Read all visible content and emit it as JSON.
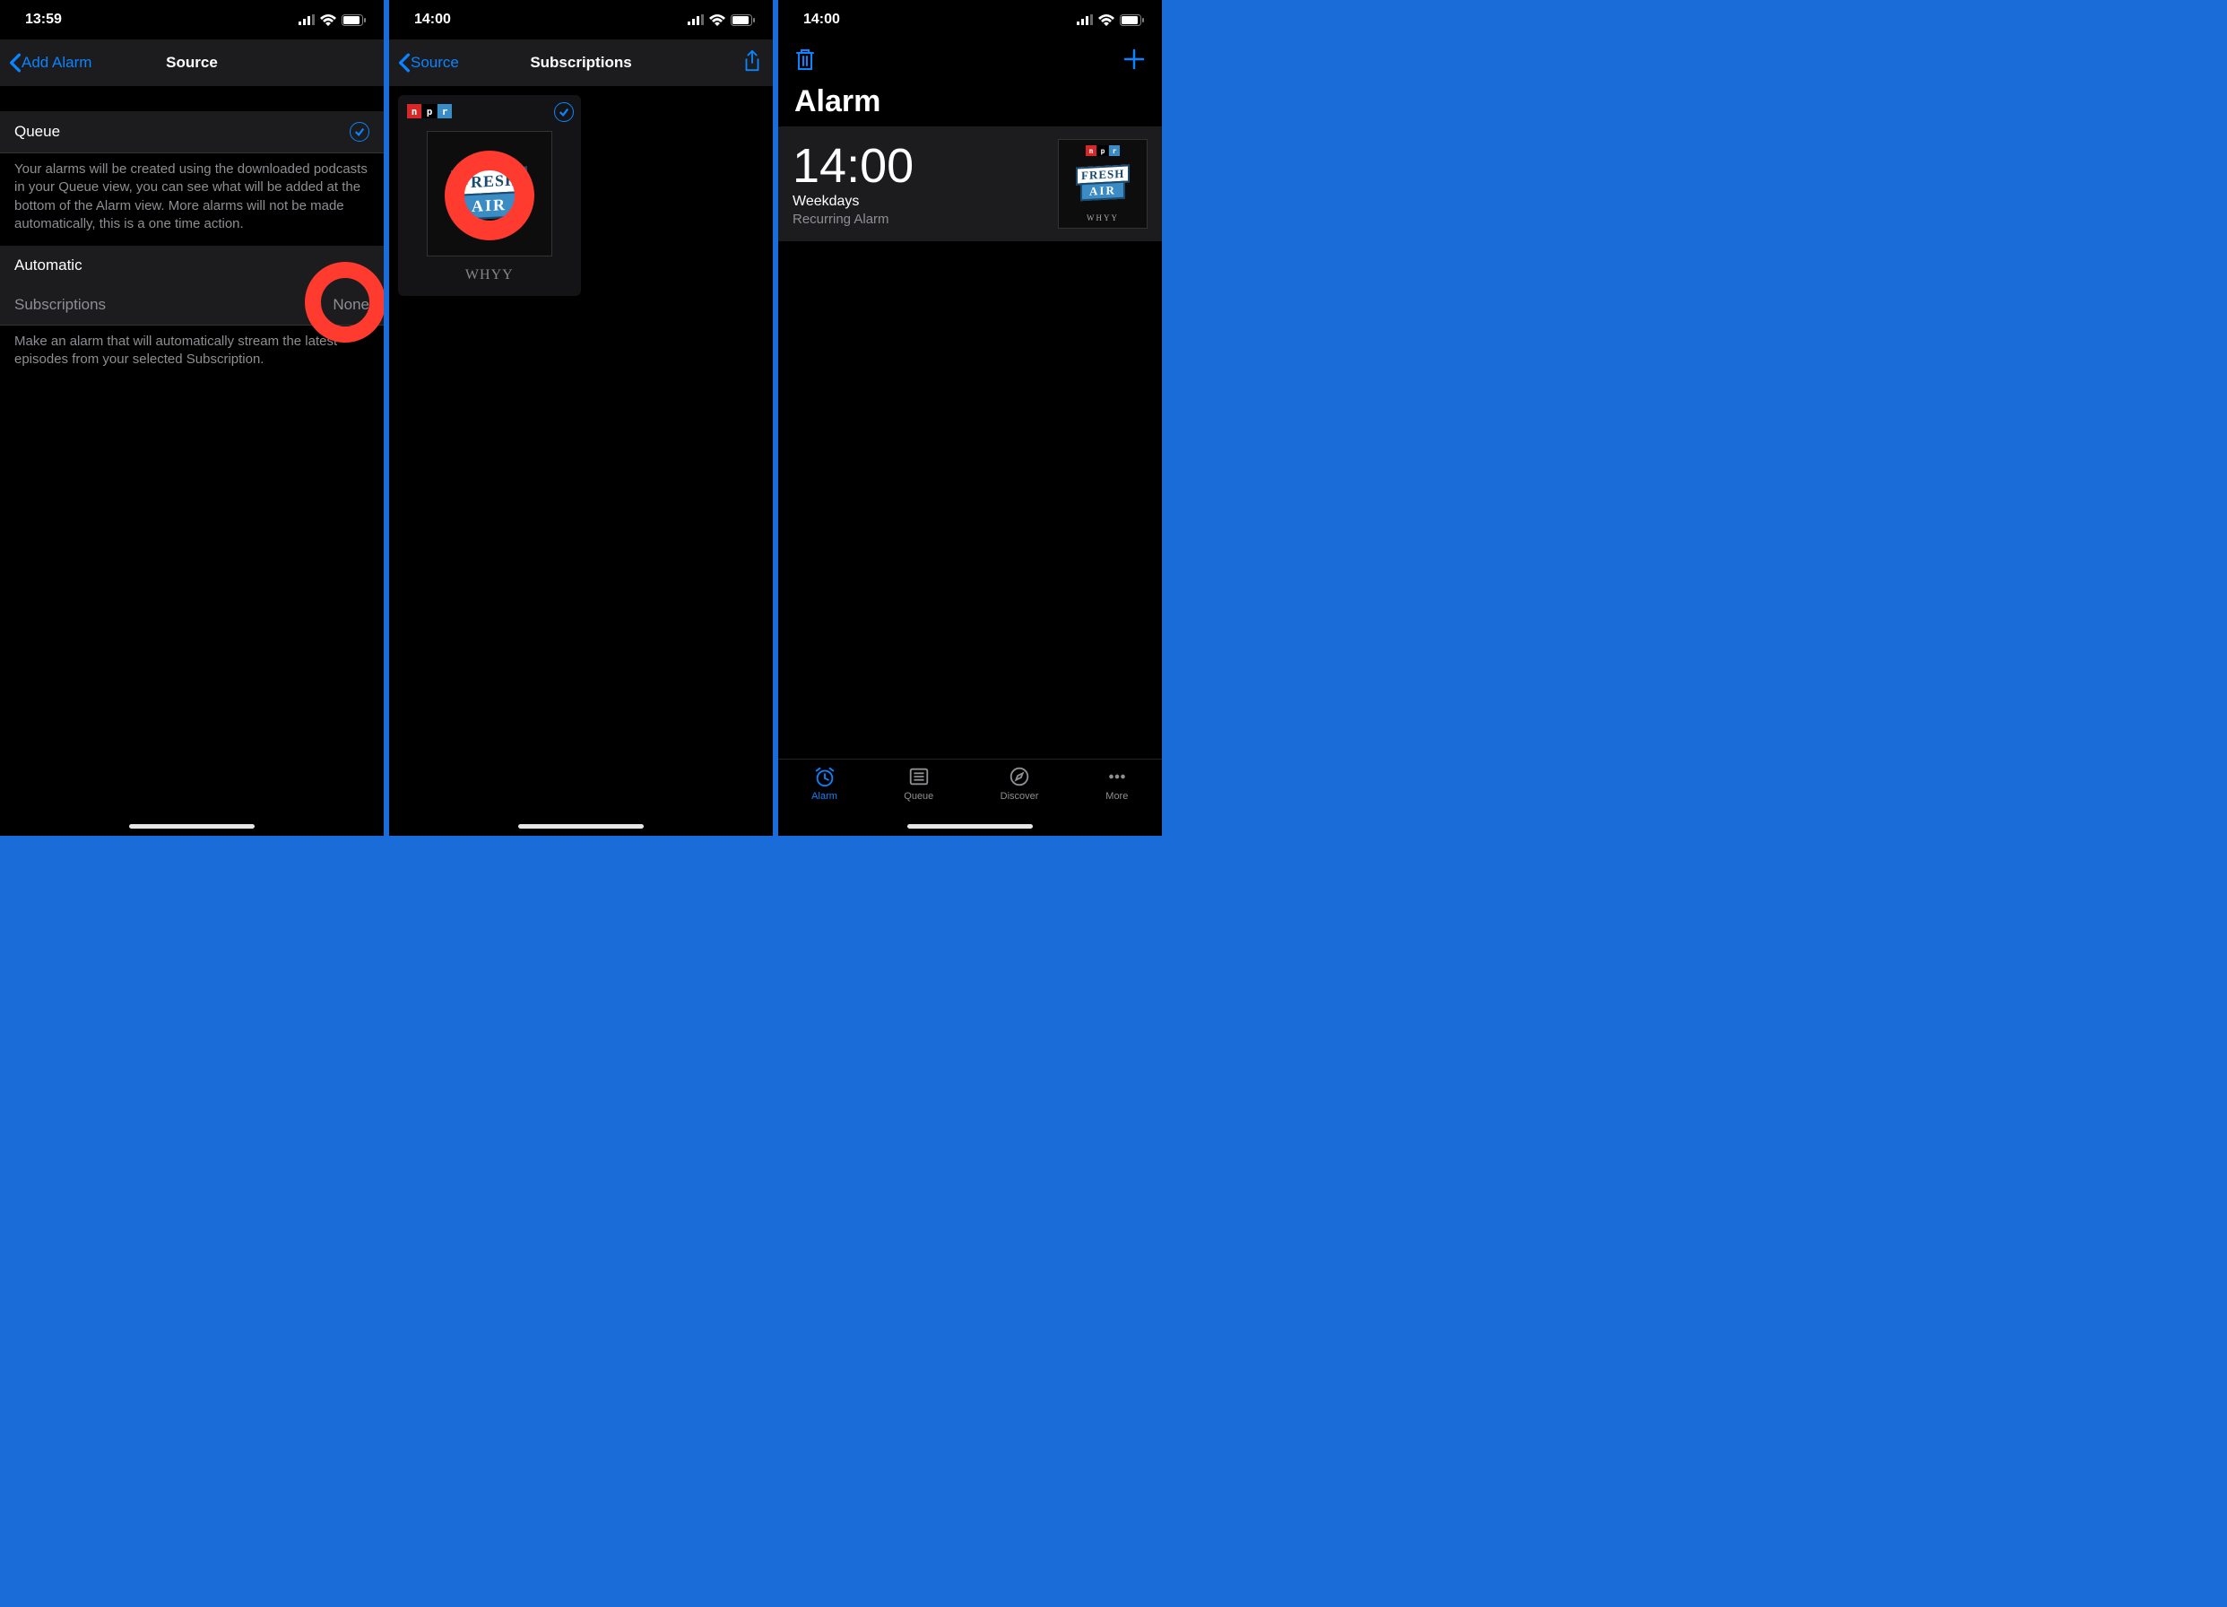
{
  "screens": [
    {
      "status_time": "13:59",
      "nav_back": "Add Alarm",
      "nav_title": "Source",
      "queue_label": "Queue",
      "queue_footer": "Your alarms will be created using the downloaded podcasts in your Queue view, you can see what will be added at the bottom of the Alarm view. More alarms will not be made automatically, this is a one time action.",
      "automatic_label": "Automatic",
      "subscriptions_label": "Subscriptions",
      "subscriptions_value": "None",
      "automatic_footer": "Make an alarm that will automatically stream the latest episodes from your selected Subscription."
    },
    {
      "status_time": "14:00",
      "nav_back": "Source",
      "nav_title": "Subscriptions",
      "podcast_station": "WHYY",
      "art_line1": "FRESH",
      "art_line2": "AIR"
    },
    {
      "status_time": "14:00",
      "page_title": "Alarm",
      "alarm_time": "14:00",
      "alarm_days": "Weekdays",
      "alarm_type": "Recurring Alarm",
      "art_line1": "FRESH",
      "art_line2": "AIR",
      "art_station": "WHYY",
      "tabs": [
        "Alarm",
        "Queue",
        "Discover",
        "More"
      ]
    }
  ],
  "npr": [
    "n",
    "p",
    "r"
  ]
}
